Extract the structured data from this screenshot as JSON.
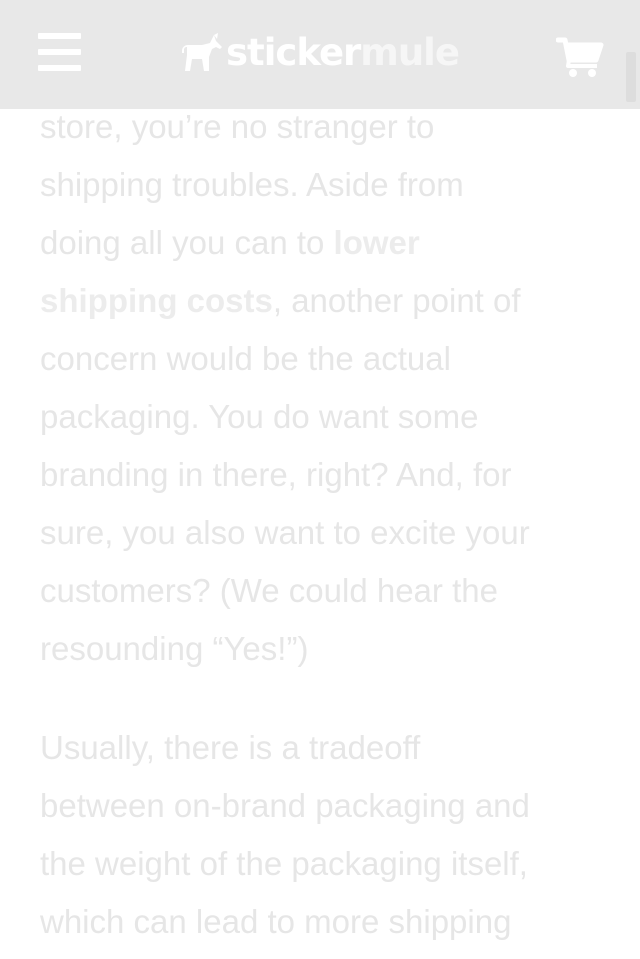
{
  "header": {
    "logo_part1": "sticker",
    "logo_part2": "mule",
    "menu_icon": "hamburger-menu-icon",
    "cart_icon": "shopping-cart-icon",
    "logo_icon": "mule-logo-icon",
    "colors": {
      "bar": "#e8e8e8",
      "icon": "#ffffff",
      "text": "#e6e6e6"
    }
  },
  "article": {
    "p1_lines": [
      "store, you’re no stranger to",
      "shipping troubles. Aside from",
      "doing all you can to ",
      "lower",
      "shipping costs",
      ", another point of",
      "concern would be the actual",
      "packaging. You do want some",
      "branding in there, right? And, for",
      "sure, you also want to excite your",
      "customers? (We could hear the",
      "resounding “Yes!”)"
    ],
    "p2_lines": [
      "Usually, there is a tradeoff",
      "between on-brand packaging and",
      "the weight of the packaging itself,",
      "which can lead to more shipping"
    ]
  }
}
